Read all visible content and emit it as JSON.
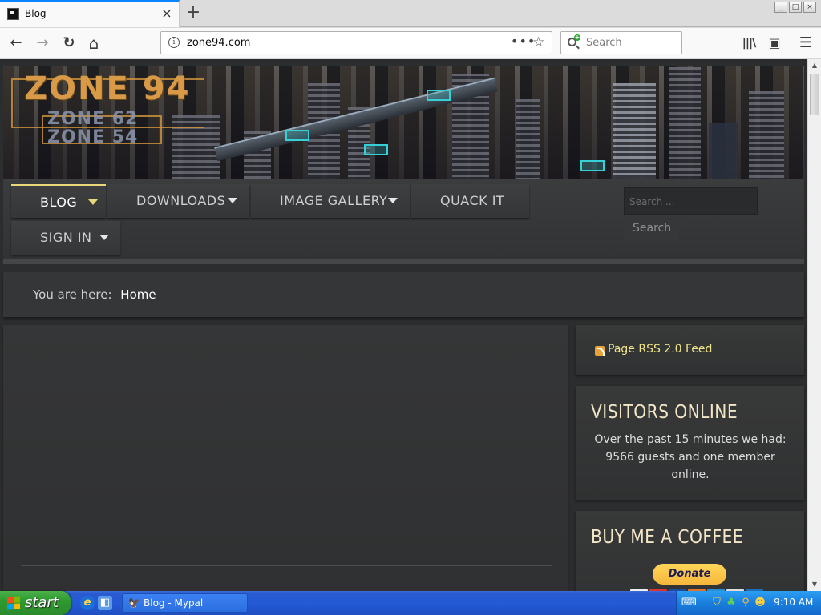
{
  "browser": {
    "tab": {
      "title": "Blog",
      "close_icon": "×"
    },
    "new_tab_icon": "+",
    "window_controls": [
      "_",
      "□",
      "×"
    ],
    "nav": {
      "back_icon": "←",
      "forward_icon": "→",
      "reload_icon": "↻",
      "home_icon": "⌂"
    },
    "url": "zone94.com",
    "url_info_icon": "i",
    "page_actions_icon": "•••",
    "bookmark_icon": "☆",
    "search_placeholder": "Search",
    "library_icon": "|||\\",
    "sidebar_icon": "▣",
    "menu_icon": "☰"
  },
  "site": {
    "logo": {
      "main": "ZONE 94",
      "sub1": "ZONE 62",
      "sub2": "ZONE 54"
    },
    "menu": [
      {
        "label": "BLOG",
        "has_dropdown": true,
        "active": true
      },
      {
        "label": "DOWNLOADS",
        "has_dropdown": true,
        "active": false
      },
      {
        "label": "IMAGE GALLERY",
        "has_dropdown": true,
        "active": false
      },
      {
        "label": "QUACK IT",
        "has_dropdown": false,
        "active": false
      },
      {
        "label": "SIGN IN",
        "has_dropdown": true,
        "active": false
      }
    ],
    "search": {
      "placeholder": "Search ...",
      "button": "Search"
    },
    "breadcrumb": {
      "prefix": "You are here:",
      "current": "Home"
    },
    "sidebar": {
      "rss": "Page RSS 2.0 Feed",
      "visitors": {
        "title": "VISITORS ONLINE",
        "text": "Over the past 15 minutes we had: 9566 guests and one member online."
      },
      "coffee": {
        "title": "BUY ME A COFFEE",
        "donate": "Donate"
      }
    },
    "colors": {
      "accent": "#e9d77a",
      "panel": "#353637",
      "background": "#2c2d2e"
    }
  },
  "taskbar": {
    "start_label": "start",
    "task": "Blog - Mypal",
    "time": "9:10 AM"
  }
}
